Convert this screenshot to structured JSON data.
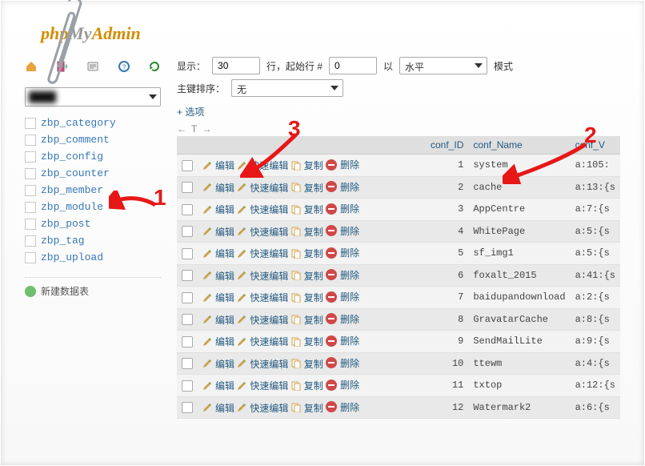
{
  "brand_prefix": "php",
  "brand_mid": "My",
  "brand_suffix": "Admin",
  "sidebar": {
    "tables": [
      "zbp_category",
      "zbp_comment",
      "zbp_config",
      "zbp_counter",
      "zbp_member",
      "zbp_module",
      "zbp_post",
      "zbp_tag",
      "zbp_upload"
    ],
    "new_table": "新建数据表"
  },
  "controls": {
    "display_label": "显示：",
    "display_value": "30",
    "rows_start_label": "行，起始行 #",
    "start_value": "0",
    "with_label": "以",
    "mode_value": "水平",
    "mode_trailing": "模式",
    "pk_sort_label": "主键排序：",
    "pk_sort_value": "无",
    "options": "+ 选项",
    "prev": "←",
    "sort_t": "T",
    "next": "→"
  },
  "columns": {
    "conf_id": "conf_ID",
    "conf_name": "conf_Name",
    "conf_v": "conf_V"
  },
  "action_labels": {
    "edit": "编辑",
    "inline": "快速编辑",
    "copy": "复制",
    "delete": "删除"
  },
  "rows": [
    {
      "conf_id": 1,
      "conf_name": "system",
      "conf_v": "a:105:"
    },
    {
      "conf_id": 2,
      "conf_name": "cache",
      "conf_v": "a:13:{s"
    },
    {
      "conf_id": 3,
      "conf_name": "AppCentre",
      "conf_v": "a:7:{s"
    },
    {
      "conf_id": 4,
      "conf_name": "WhitePage",
      "conf_v": "a:5:{s"
    },
    {
      "conf_id": 5,
      "conf_name": "sf_img1",
      "conf_v": "a:5:{s"
    },
    {
      "conf_id": 6,
      "conf_name": "foxalt_2015",
      "conf_v": "a:41:{s"
    },
    {
      "conf_id": 7,
      "conf_name": "baidupandownload",
      "conf_v": "a:2:{s"
    },
    {
      "conf_id": 8,
      "conf_name": "GravatarCache",
      "conf_v": "a:8:{s"
    },
    {
      "conf_id": 9,
      "conf_name": "SendMailLite",
      "conf_v": "a:9:{s"
    },
    {
      "conf_id": 10,
      "conf_name": "ttewm",
      "conf_v": "a:4:{s"
    },
    {
      "conf_id": 11,
      "conf_name": "txtop",
      "conf_v": "a:12:{s"
    },
    {
      "conf_id": 12,
      "conf_name": "Watermark2",
      "conf_v": "a:6:{s"
    }
  ],
  "annotations": {
    "one": "1",
    "two": "2",
    "three": "3"
  }
}
